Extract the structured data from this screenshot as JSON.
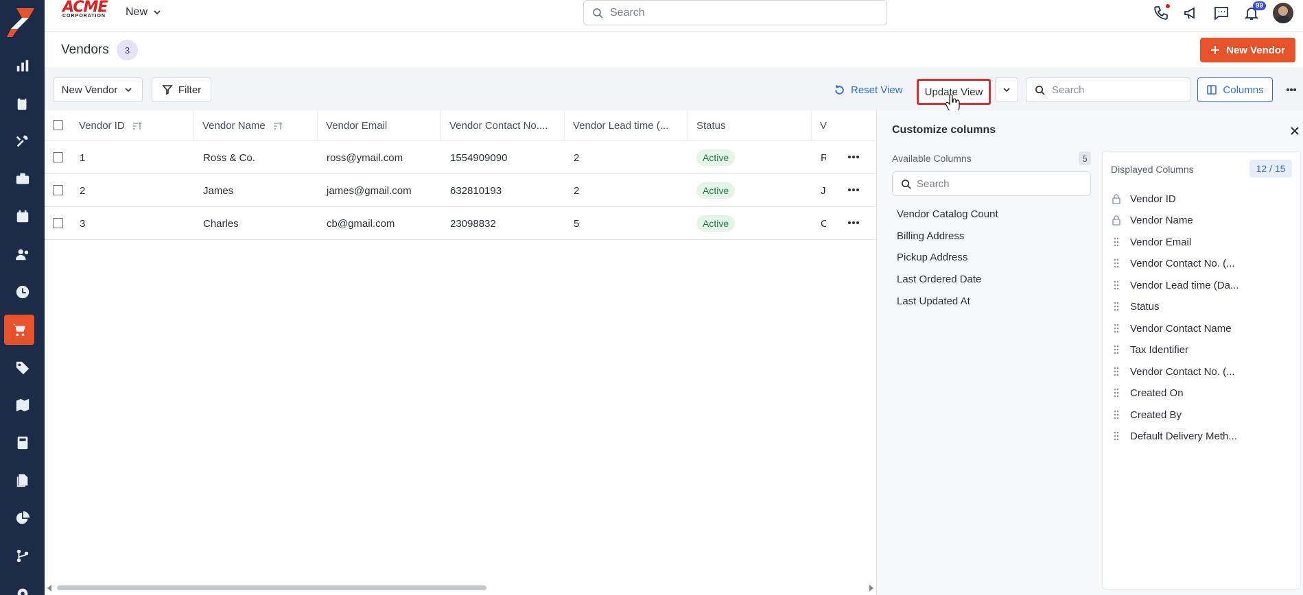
{
  "app": {
    "brand_line1": "ACME",
    "brand_line2": "CORPORATION",
    "new_menu": "New",
    "search_placeholder": "Search",
    "notification_badge": "99"
  },
  "sidebar": {
    "icons": [
      "logo-icon",
      "chart-icon",
      "clipboard-icon",
      "tools-icon",
      "briefcase-icon",
      "calendar-icon",
      "people-icon",
      "clock-icon",
      "cart-icon",
      "tag-icon",
      "map-icon",
      "calculator-icon",
      "documents-icon",
      "pie-chart-icon",
      "workflow-icon",
      "gear-icon"
    ],
    "active": "cart-icon"
  },
  "header": {
    "title": "Vendors",
    "count": "3",
    "new_vendor_label": "New Vendor"
  },
  "toolbar": {
    "view_select": "New Vendor",
    "filter_label": "Filter",
    "reset_view_label": "Reset View",
    "update_view_label": "Update View",
    "search_placeholder": "Search",
    "columns_label": "Columns"
  },
  "table": {
    "columns": [
      "Vendor ID",
      "Vendor Name",
      "Vendor Email",
      "Vendor Contact No....",
      "Vendor Lead time (...",
      "Status",
      "V"
    ],
    "rows": [
      {
        "id": "1",
        "name": "Ross & Co.",
        "email": "ross@ymail.com",
        "contact": "1554909090",
        "lead": "2",
        "status": "Active",
        "extra": "R"
      },
      {
        "id": "2",
        "name": "James",
        "email": "james@gmail.com",
        "contact": "632810193",
        "lead": "2",
        "status": "Active",
        "extra": "J"
      },
      {
        "id": "3",
        "name": "Charles",
        "email": "cb@gmail.com",
        "contact": "23098832",
        "lead": "5",
        "status": "Active",
        "extra": "C"
      }
    ]
  },
  "panel": {
    "title": "Customize columns",
    "available_title": "Available Columns",
    "available_count": "5",
    "available_search_placeholder": "Search",
    "available": [
      "Vendor Catalog Count",
      "Billing Address",
      "Pickup Address",
      "Last Ordered Date",
      "Last Updated At"
    ],
    "displayed_title": "Displayed Columns",
    "displayed_count": "12 / 15",
    "displayed": [
      {
        "label": "Vendor ID",
        "locked": true
      },
      {
        "label": "Vendor Name",
        "locked": true
      },
      {
        "label": "Vendor Email",
        "locked": false
      },
      {
        "label": "Vendor Contact No. (...",
        "locked": false
      },
      {
        "label": "Vendor Lead time (Da...",
        "locked": false
      },
      {
        "label": "Status",
        "locked": false
      },
      {
        "label": "Vendor Contact Name",
        "locked": false
      },
      {
        "label": "Tax Identifier",
        "locked": false
      },
      {
        "label": "Vendor Contact No. (...",
        "locked": false
      },
      {
        "label": "Created On",
        "locked": false
      },
      {
        "label": "Created By",
        "locked": false
      },
      {
        "label": "Default Delivery Meth...",
        "locked": false
      }
    ]
  },
  "colors": {
    "accent": "#e8522a",
    "sidebar_bg": "#1c2b47",
    "link_blue": "#2f6fd6",
    "highlight_red": "#d83030"
  }
}
